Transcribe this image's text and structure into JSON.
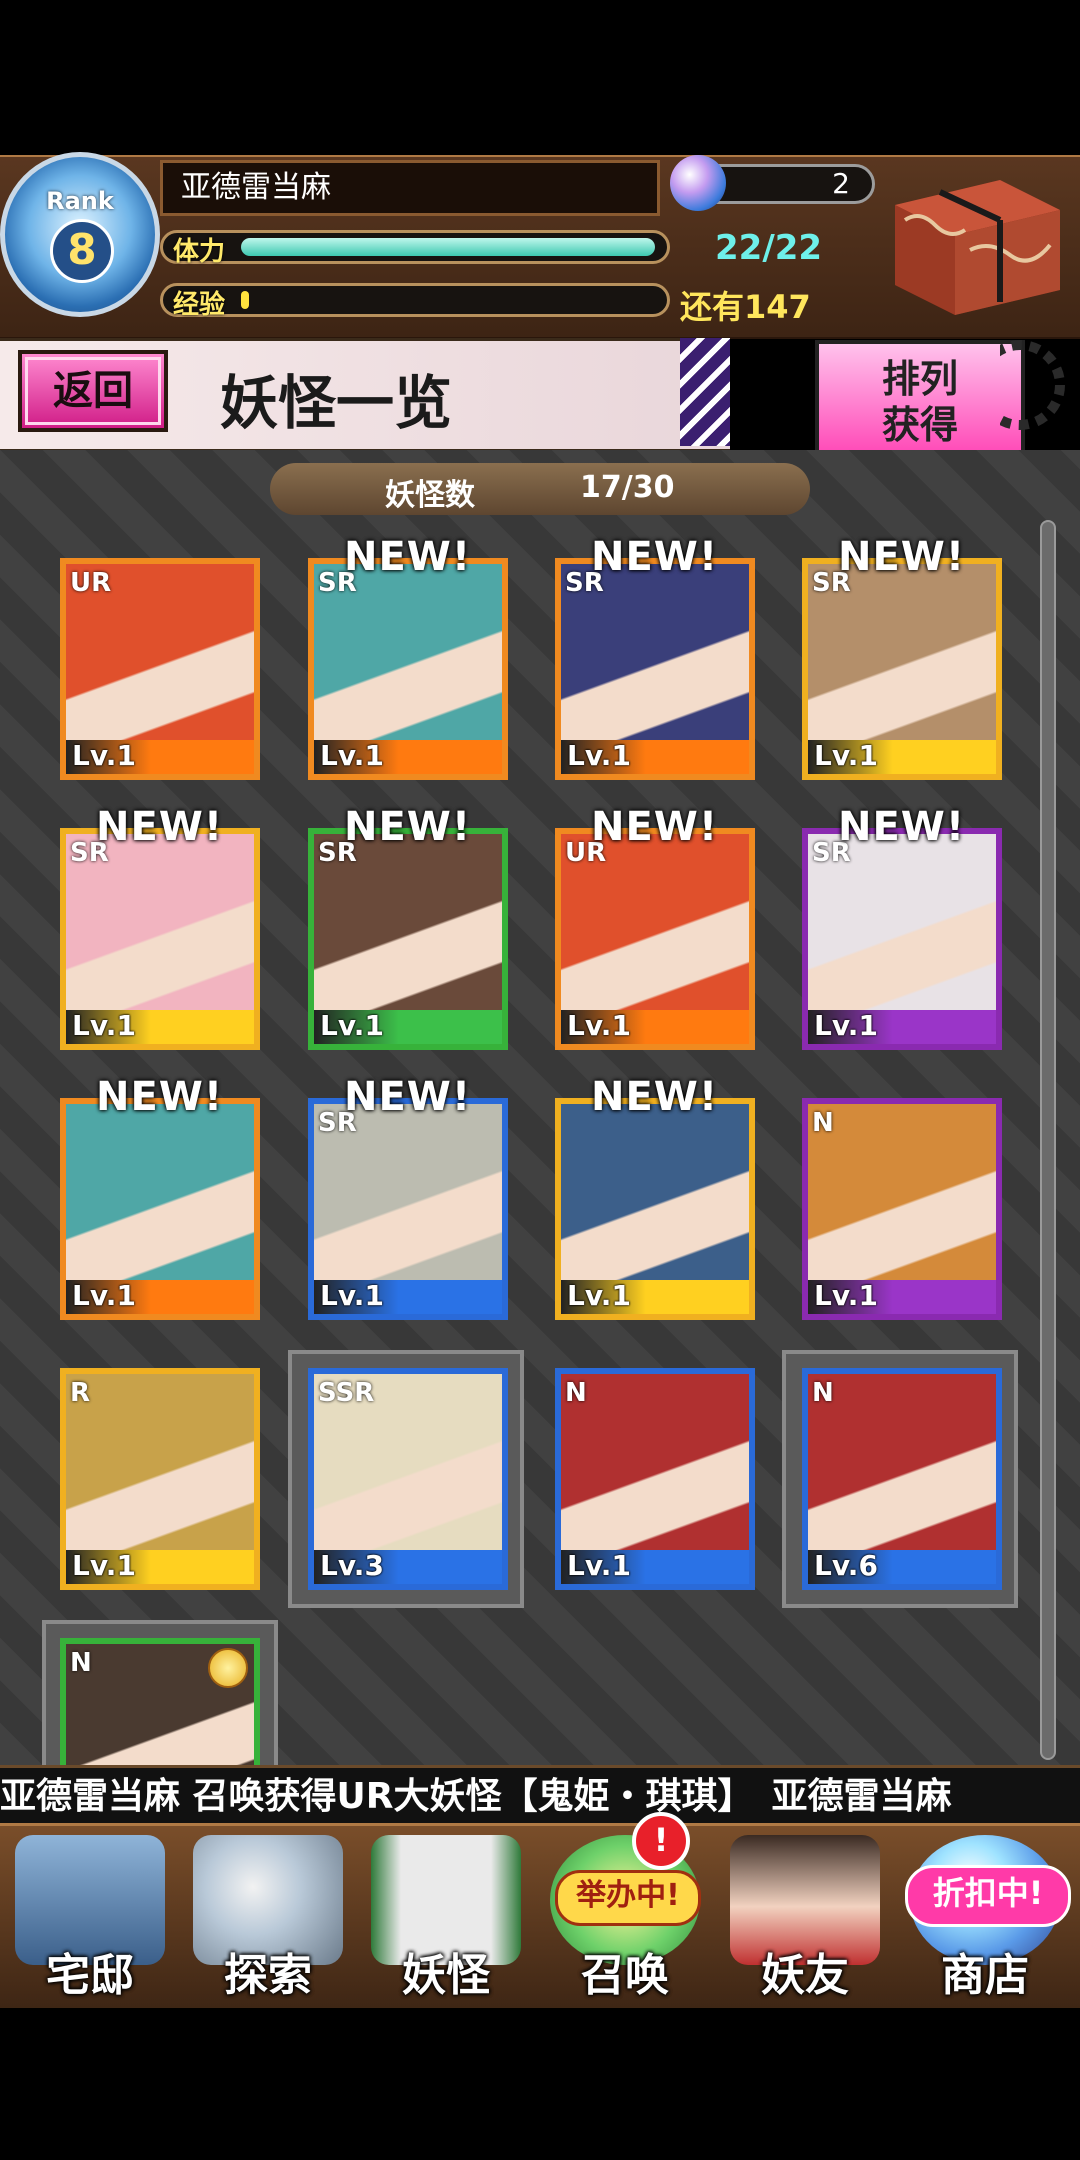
{
  "player": {
    "rank_label": "Rank",
    "rank": "8",
    "name": "亚德雷当麻",
    "stamina_label": "体力",
    "stamina_value": "22/22",
    "stamina_fraction": 1.0,
    "exp_label": "经验",
    "exp_value": "还有147",
    "exp_fraction": 0.02,
    "gems": "2"
  },
  "title_bar": {
    "back_label": "返回",
    "title": "妖怪一览",
    "sort_line1": "排列",
    "sort_line2": "获得"
  },
  "counter": {
    "label": "妖怪数",
    "value": "17/30"
  },
  "cards": [
    {
      "rarity": "UR",
      "new": "",
      "level": "Lv.1",
      "frame": "#f08a20",
      "bar": "#ff7a10",
      "art": "#e0502c"
    },
    {
      "rarity": "SR",
      "new": "NEW!",
      "level": "Lv.1",
      "frame": "#f08a20",
      "bar": "#ff7a10",
      "art": "#4fa7a6"
    },
    {
      "rarity": "SR",
      "new": "NEW!",
      "level": "Lv.1",
      "frame": "#f08a20",
      "bar": "#ff7a10",
      "art": "#3a3f7a"
    },
    {
      "rarity": "SR",
      "new": "NEW!",
      "level": "Lv.1",
      "frame": "#f0b020",
      "bar": "#ffd020",
      "art": "#b48f6a"
    },
    {
      "rarity": "SR",
      "new": "NEW!",
      "level": "Lv.1",
      "frame": "#f0b020",
      "bar": "#ffd020",
      "art": "#f2b4c0"
    },
    {
      "rarity": "SR",
      "new": "NEW!",
      "level": "Lv.1",
      "frame": "#37b23a",
      "bar": "#3cc04a",
      "art": "#6a4a3a"
    },
    {
      "rarity": "UR",
      "new": "NEW!",
      "level": "Lv.1",
      "frame": "#f08a20",
      "bar": "#ff7a10",
      "art": "#e0502c"
    },
    {
      "rarity": "SR",
      "new": "NEW!",
      "level": "Lv.1",
      "frame": "#8a2ab0",
      "bar": "#9a35c8",
      "art": "#e8e2e6"
    },
    {
      "rarity": "",
      "new": "NEW!",
      "level": "Lv.1",
      "frame": "#f08a20",
      "bar": "#ff7a10",
      "art": "#4fa7a6"
    },
    {
      "rarity": "SR",
      "new": "NEW!",
      "level": "Lv.1",
      "frame": "#2a6ad8",
      "bar": "#2a72e6",
      "art": "#bcbcb0"
    },
    {
      "rarity": "",
      "new": "NEW!",
      "level": "Lv.1",
      "frame": "#f0b020",
      "bar": "#ffd020",
      "art": "#3c5f8a"
    },
    {
      "rarity": "N",
      "new": "",
      "level": "Lv.1",
      "frame": "#8a2ab0",
      "bar": "#9a35c8",
      "art": "#d48a3a"
    },
    {
      "rarity": "R",
      "new": "",
      "level": "Lv.1",
      "frame": "#f0b020",
      "bar": "#ffd020",
      "art": "#c8a24a"
    },
    {
      "rarity": "SSR",
      "new": "",
      "level": "Lv.3",
      "frame": "#2a6ad8",
      "bar": "#2a72e6",
      "art": "#e6dcc0"
    },
    {
      "rarity": "N",
      "new": "",
      "level": "Lv.1",
      "frame": "#2a6ad8",
      "bar": "#2a72e6",
      "art": "#b03030"
    },
    {
      "rarity": "N",
      "new": "",
      "level": "Lv.6",
      "frame": "#2a6ad8",
      "bar": "#2a72e6",
      "art": "#b03030"
    },
    {
      "rarity": "N",
      "new": "",
      "level": "",
      "frame": "#37b23a",
      "bar": "#3cc04a",
      "art": "#4a3a30"
    }
  ],
  "ticker": "亚德雷当麻 召唤获得UR大妖怪【鬼姫・琪琪】　亚德雷当麻",
  "nav": {
    "home": "宅邸",
    "explore": "探索",
    "yokai": "妖怪",
    "summon": "召唤",
    "summon_badge": "举办中!",
    "friends": "妖友",
    "shop": "商店",
    "shop_badge": "折扣中!"
  },
  "colors": {
    "pink_button": "#ff45b5",
    "stamina": "#3dc8b0",
    "exp": "#ffe23d"
  }
}
